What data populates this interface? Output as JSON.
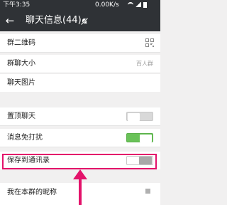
{
  "status_bar": {
    "time": "下午3:35",
    "speed": "0.00K/s"
  },
  "app_bar": {
    "title": "聊天信息(44)"
  },
  "rows": {
    "qr": {
      "label": "群二维码"
    },
    "size": {
      "label": "群聊大小",
      "value": "百人群"
    },
    "photos": {
      "label": "聊天图片"
    },
    "pin": {
      "label": "置顶聊天",
      "state": "off"
    },
    "mute": {
      "label": "消息免打扰",
      "state": "on"
    },
    "save": {
      "label": "保存到通讯录",
      "state": "off"
    },
    "nickname": {
      "label": "我在本群的昵称"
    }
  },
  "colors": {
    "accent": "#6ac259",
    "highlight": "#e3126a",
    "bar": "#2f3236"
  }
}
